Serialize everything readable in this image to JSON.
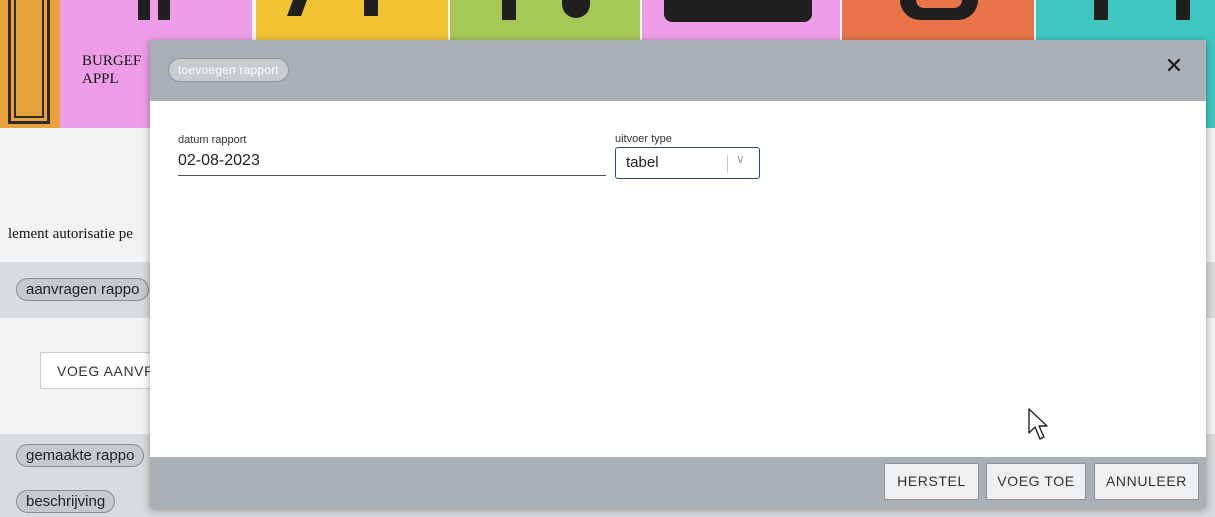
{
  "background": {
    "tile_label_line1": "BURGEF",
    "tile_label_line2": "APPL",
    "section_text": "lement autorisatie pe",
    "chip_request": "aanvragen rappo",
    "add_request_button": "VOEG AANVR",
    "chip_made": "gemaakte rappo",
    "chip_description": "beschrijving"
  },
  "modal": {
    "title": "toevoegen rapport",
    "close_icon": "close-icon",
    "date_label": "datum rapport",
    "date_value": "02-08-2023",
    "output_label": "uitvoer type",
    "output_value": "tabel",
    "buttons": {
      "reset": "HERSTEL",
      "add": "VOEG TOE",
      "cancel": "ANNULEER"
    }
  },
  "colors": {
    "header_footer": "#a9b0b6",
    "tile_orange": "#e8a23c",
    "tile_pink": "#ee9ee8",
    "tile_yellow": "#f1c232",
    "tile_green": "#a6c857",
    "tile_red": "#e9744a",
    "tile_teal": "#3ec6c0"
  }
}
